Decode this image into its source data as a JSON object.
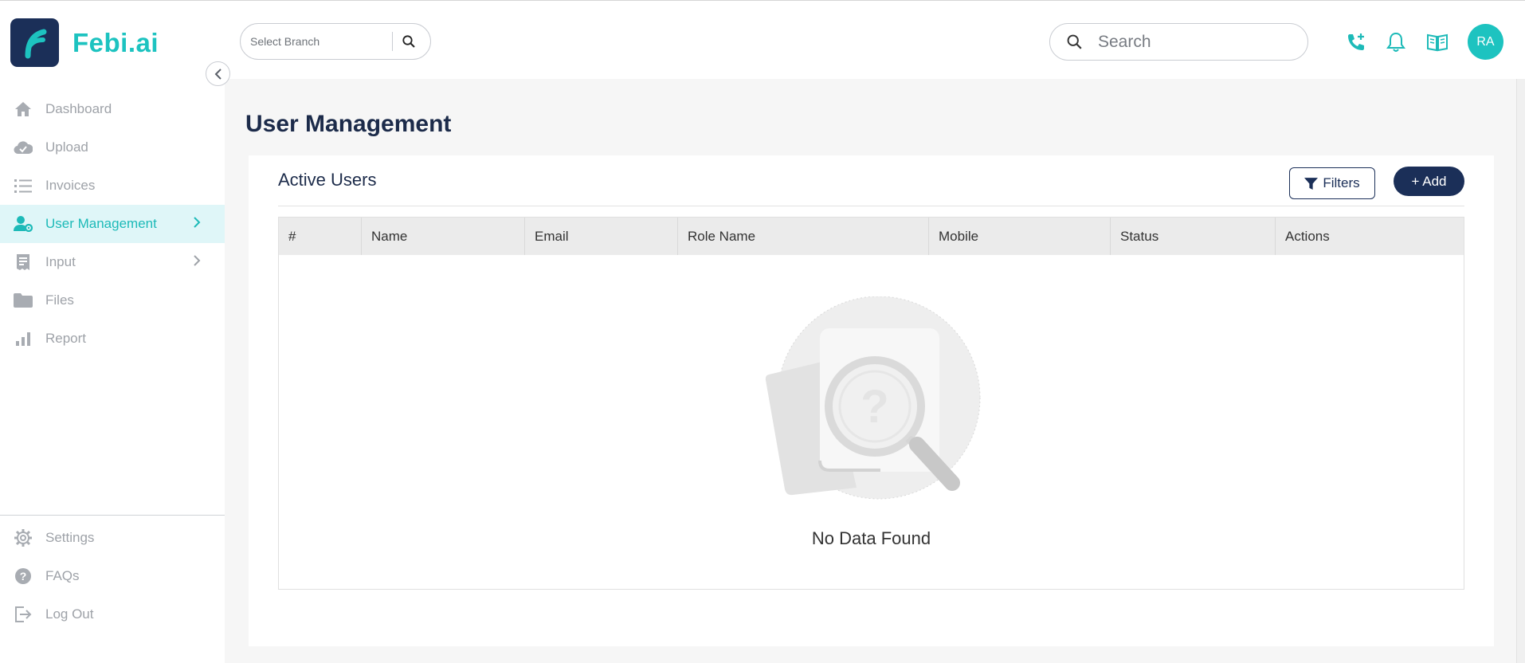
{
  "brand": {
    "name": "Febi.ai"
  },
  "sidebar": {
    "items": [
      {
        "label": "Dashboard",
        "icon": "home-icon"
      },
      {
        "label": "Upload",
        "icon": "cloud-upload-icon"
      },
      {
        "label": "Invoices",
        "icon": "list-icon"
      },
      {
        "label": "User Management",
        "icon": "user-settings-icon",
        "active": true
      },
      {
        "label": "Input",
        "icon": "receipt-icon"
      },
      {
        "label": "Files",
        "icon": "folder-icon"
      },
      {
        "label": "Report",
        "icon": "bar-chart-icon"
      }
    ],
    "bottom_items": [
      {
        "label": "Settings",
        "icon": "gear-icon"
      },
      {
        "label": "FAQs",
        "icon": "question-icon"
      },
      {
        "label": "Log Out",
        "icon": "logout-icon"
      }
    ]
  },
  "header": {
    "branch_placeholder": "Select Branch",
    "search_placeholder": "Search",
    "avatar_initials": "RA"
  },
  "main": {
    "page_title": "User Management",
    "card_title": "Active Users",
    "filters_label": "Filters",
    "add_label": "+ Add",
    "table": {
      "columns": [
        "#",
        "Name",
        "Email",
        "Role Name",
        "Mobile",
        "Status",
        "Actions"
      ],
      "rows": []
    },
    "empty_text": "No Data Found"
  },
  "colors": {
    "accent": "#1dc3c0",
    "navy": "#1b2f58",
    "active_bg": "#dff6f8",
    "muted": "#9ea2a8"
  }
}
